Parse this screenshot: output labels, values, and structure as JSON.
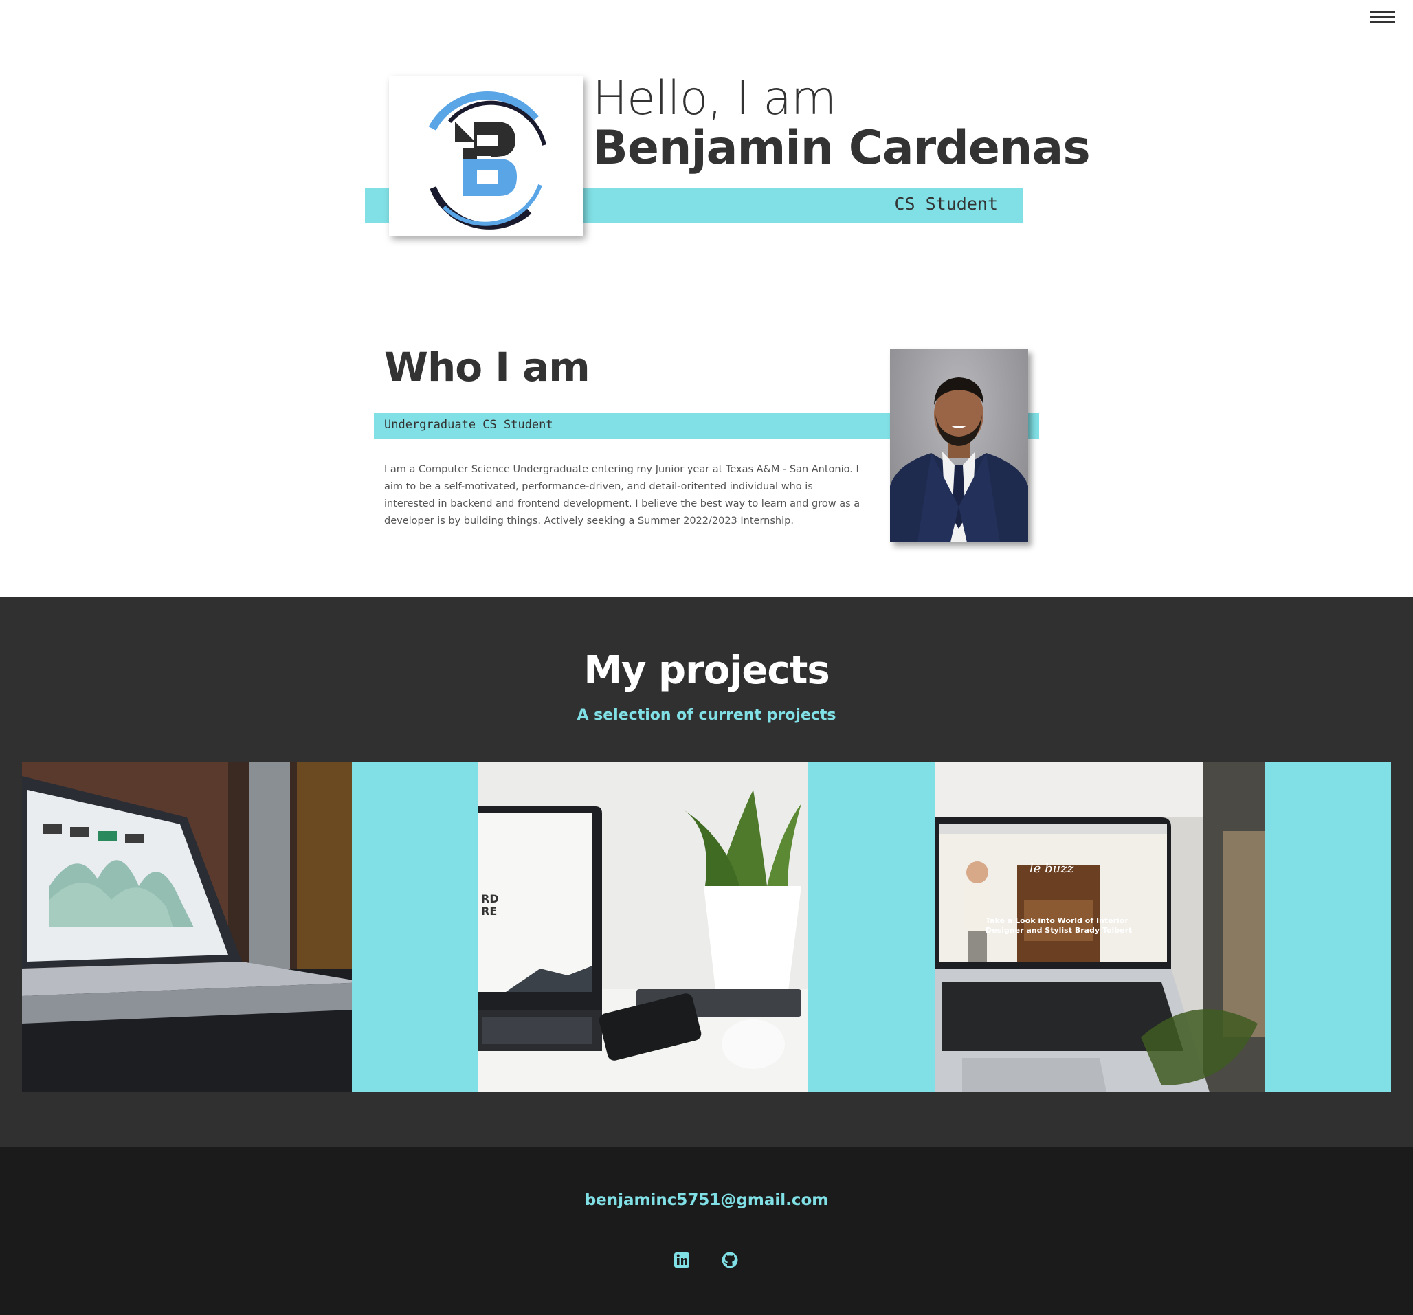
{
  "nav": {
    "menu_icon": "hamburger-menu-icon"
  },
  "hero": {
    "greeting": "Hello, I am",
    "name": "Benjamin Cardenas",
    "role": "CS Student",
    "logo_letter": "B"
  },
  "about": {
    "title": "Who I am",
    "subtitle": "Undergraduate CS Student",
    "body": "I am a Computer Science Undergraduate entering my Junior year at Texas A&M - San Antonio. I aim to be a self-motivated, performance-driven, and detail-oritented individual who is interested in backend and frontend development. I believe the best way to learn and grow as a developer is by building things. Actively seeking a Summer 2022/2023 Internship."
  },
  "projects": {
    "title": "My projects",
    "subtitle": "A selection of current projects",
    "screen_text_2": "RD\nRE",
    "screen_text_3_logo": "le buzz",
    "screen_text_3_headline": "Take a Look into World of Interior Designer and Stylist Brady Tolbert"
  },
  "footer": {
    "email": "benjaminc5751@gmail.com",
    "icons": [
      "linkedin-icon",
      "github-icon"
    ]
  },
  "colors": {
    "accent": "#80e0e5",
    "dark": "#303030",
    "footer": "#1b1b1b",
    "text": "#333333"
  }
}
